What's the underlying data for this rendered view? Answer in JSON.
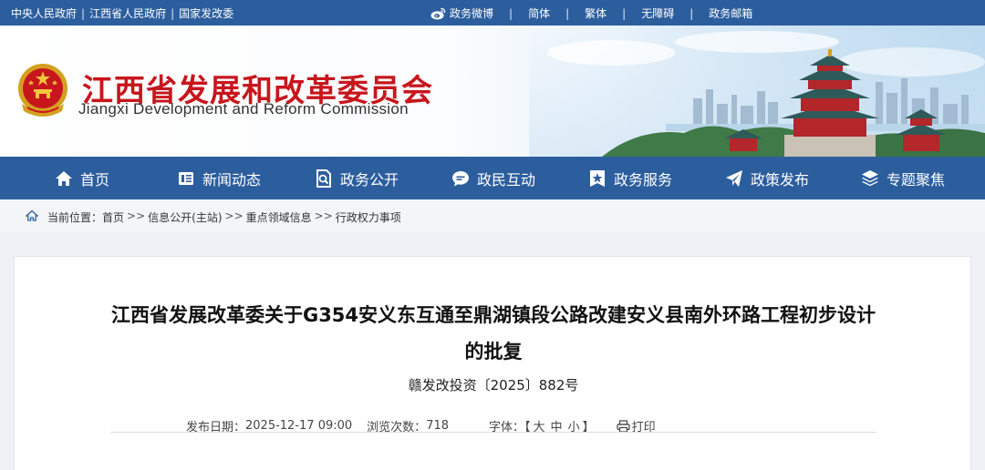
{
  "topbar": {
    "links": [
      "中央人民政府",
      "江西省人民政府",
      "国家发改委"
    ],
    "separator": "|",
    "right": [
      {
        "label": "政务微博",
        "icon": "weibo-icon"
      },
      {
        "label": "简体"
      },
      {
        "label": "繁体"
      },
      {
        "label": "无障碍"
      },
      {
        "label": "政务邮箱"
      }
    ]
  },
  "header": {
    "title": "江西省发展和改革委员会",
    "subtitle": "Jiangxi Development and Reform Commission",
    "emblem": "national-emblem"
  },
  "nav": [
    {
      "label": "首页",
      "icon": "home-icon"
    },
    {
      "label": "新闻动态",
      "icon": "news-icon"
    },
    {
      "label": "政务公开",
      "icon": "document-search-icon"
    },
    {
      "label": "政民互动",
      "icon": "chat-icon"
    },
    {
      "label": "政务服务",
      "icon": "star-badge-icon"
    },
    {
      "label": "政策发布",
      "icon": "paper-plane-icon"
    },
    {
      "label": "专题聚焦",
      "icon": "layers-icon"
    }
  ],
  "breadcrumb": {
    "prefix": "当前位置：",
    "items": [
      "首页",
      "信息公开(主站)",
      "重点领域信息",
      "行政权力事项"
    ],
    "arrow": ">>"
  },
  "article": {
    "title_line1": "江西省发展改革委关于G354安义东互通至鼎湖镇段公路改建安义县南外环路工程初步设计",
    "title_line2": "的批复",
    "doc_number": "赣发改投资〔2025〕882号",
    "publish_label": "发布日期：",
    "publish_date": "2025-12-17 09:00",
    "views_label": "浏览次数：",
    "views": "718",
    "font_label": "字体：【",
    "font_large": "大",
    "font_medium": "中",
    "font_small": "小",
    "font_close": "】",
    "print_label": "打印"
  },
  "colors": {
    "primary": "#2c5e9e",
    "title_red": "#c8161d"
  }
}
